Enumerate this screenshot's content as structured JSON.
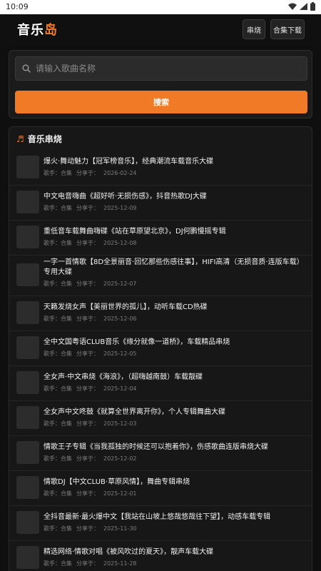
{
  "status": {
    "time": "10:09"
  },
  "header": {
    "logo_part1": "音乐",
    "logo_part2": "岛",
    "buttons": [
      "串烧",
      "合集下载"
    ]
  },
  "search": {
    "placeholder": "请输入歌曲名称",
    "button_label": "搜索"
  },
  "section": {
    "title": "音乐串烧"
  },
  "meta_labels": {
    "singer": "歌手：合集",
    "share": "分享于："
  },
  "items": [
    {
      "title": "爆火·舞动魅力【冠军榜音乐】，经典潮流车载音乐大碟",
      "date": "2026-02-24"
    },
    {
      "title": "中文电音嗨曲《超好听·无损伤感》，抖音热歌DJ大碟",
      "date": "2025-12-09"
    },
    {
      "title": "重低音车载舞曲嗨碟《站在草原望北京》，DJ何鹏慢摇专辑",
      "date": "2025-12-08"
    },
    {
      "title": "一字一首情歌【8D全景丽音·回忆那些伤感往事】，HIFI高清（无损音质·连版车载）专用大碟",
      "date": "2025-12-07"
    },
    {
      "title": "天籁发烧女声【美丽世界的孤儿】，动听车载CD热碟",
      "date": "2025-12-06"
    },
    {
      "title": "全中文国粤语CLUB音乐《缘分就像一道桥》，车载精品串烧",
      "date": "2025-12-05"
    },
    {
      "title": "全女声·中文串烧《海浪》，（超嗨越南鼓）车载靓碟",
      "date": "2025-12-04"
    },
    {
      "title": "全女声中文咚鼓《就算全世界离开你》，个人专辑舞曲大碟",
      "date": "2025-12-03"
    },
    {
      "title": "情歌王子专辑《当我孤独的时候还可以抱着你》，伤感歌曲连版串烧大碟",
      "date": "2025-12-02"
    },
    {
      "title": "情歌DJ【中文CLUB·草原风情】，舞曲专辑串烧",
      "date": "2025-12-01"
    },
    {
      "title": "全抖音最新·最火爆中文【我站在山坡上悠哉悠哉往下望】，动感车载专辑",
      "date": "2025-11-30"
    },
    {
      "title": "精选网络·情歌对唱《被风吹过的夏天》，靓声车载大碟",
      "date": "2025-11-28"
    }
  ]
}
